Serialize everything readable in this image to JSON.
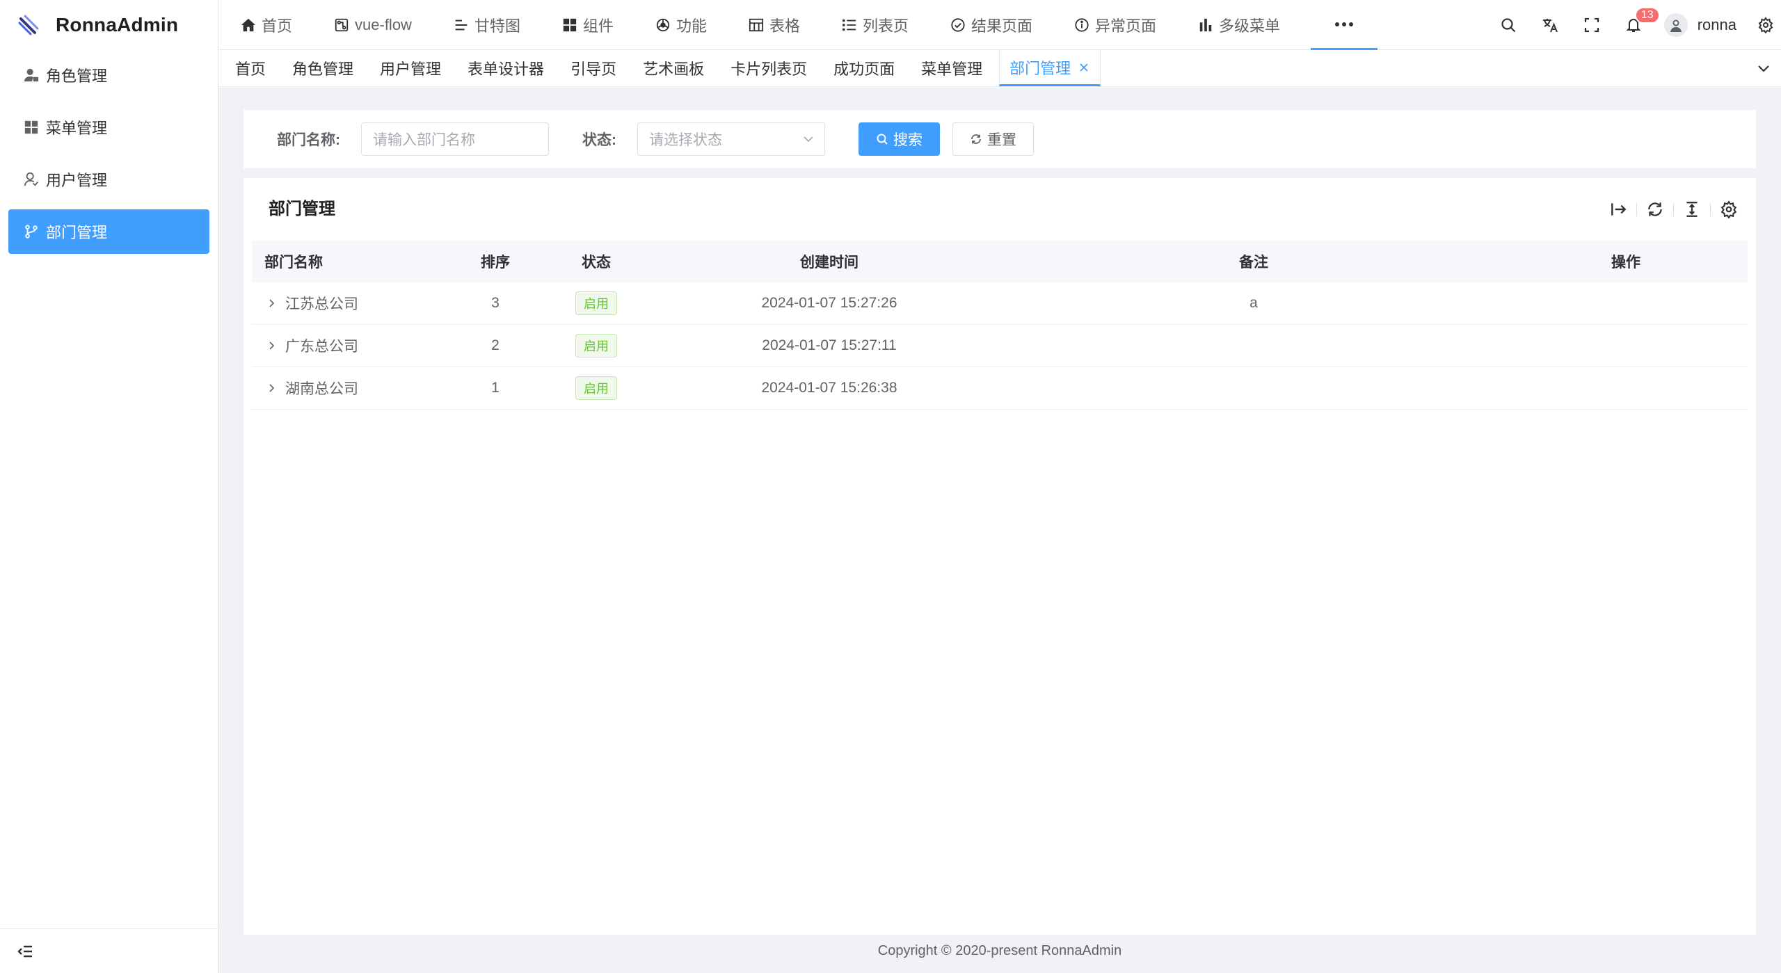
{
  "app": {
    "title": "RonnaAdmin"
  },
  "sidebar": {
    "items": [
      {
        "label": "角色管理",
        "icon": "user-role-icon",
        "active": false
      },
      {
        "label": "菜单管理",
        "icon": "grid-icon",
        "active": false
      },
      {
        "label": "用户管理",
        "icon": "user-icon",
        "active": false
      },
      {
        "label": "部门管理",
        "icon": "branch-icon",
        "active": true
      }
    ]
  },
  "topnav": {
    "items": [
      {
        "label": "首页",
        "icon": "home-icon"
      },
      {
        "label": "vue-flow",
        "icon": "flow-icon"
      },
      {
        "label": "甘特图",
        "icon": "gantt-icon"
      },
      {
        "label": "组件",
        "icon": "grid-icon"
      },
      {
        "label": "功能",
        "icon": "function-icon"
      },
      {
        "label": "表格",
        "icon": "table-icon"
      },
      {
        "label": "列表页",
        "icon": "list-icon"
      },
      {
        "label": "结果页面",
        "icon": "check-circle-icon"
      },
      {
        "label": "异常页面",
        "icon": "info-circle-icon"
      },
      {
        "label": "多级菜单",
        "icon": "bar-chart-icon"
      }
    ],
    "more_icon": "more-dots-icon"
  },
  "header": {
    "notification_count": "13",
    "username": "ronna"
  },
  "tabs": {
    "items": [
      {
        "label": "首页",
        "active": false
      },
      {
        "label": "角色管理",
        "active": false
      },
      {
        "label": "用户管理",
        "active": false
      },
      {
        "label": "表单设计器",
        "active": false
      },
      {
        "label": "引导页",
        "active": false
      },
      {
        "label": "艺术画板",
        "active": false
      },
      {
        "label": "卡片列表页",
        "active": false
      },
      {
        "label": "成功页面",
        "active": false
      },
      {
        "label": "菜单管理",
        "active": false
      },
      {
        "label": "部门管理",
        "active": true
      }
    ]
  },
  "search": {
    "name_label": "部门名称:",
    "name_placeholder": "请输入部门名称",
    "status_label": "状态:",
    "status_placeholder": "请选择状态",
    "search_button": "搜索",
    "reset_button": "重置"
  },
  "table": {
    "title": "部门管理",
    "columns": [
      "部门名称",
      "排序",
      "状态",
      "创建时间",
      "备注",
      "操作"
    ],
    "rows": [
      {
        "name": "江苏总公司",
        "sort": "3",
        "status": "启用",
        "created": "2024-01-07 15:27:26",
        "remark": "a",
        "op": ""
      },
      {
        "name": "广东总公司",
        "sort": "2",
        "status": "启用",
        "created": "2024-01-07 15:27:11",
        "remark": "",
        "op": ""
      },
      {
        "name": "湖南总公司",
        "sort": "1",
        "status": "启用",
        "created": "2024-01-07 15:26:38",
        "remark": "",
        "op": ""
      }
    ]
  },
  "footer": {
    "copyright": "Copyright © 2020-present RonnaAdmin"
  },
  "colors": {
    "primary": "#409eff",
    "success": "#67c23a",
    "danger": "#f56c6c",
    "background": "#f0f2f5"
  }
}
